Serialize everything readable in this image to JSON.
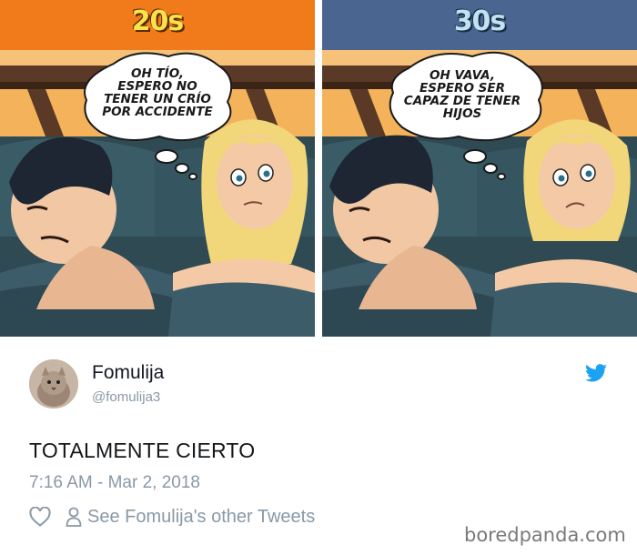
{
  "comic": {
    "panels": [
      {
        "title": "20s",
        "header_color": "#f17b1a",
        "bubble_text": "OH TÍO,\nESPERO NO\nTENER  UN CRÍO\nPOR ACCIDENTE"
      },
      {
        "title": "30s",
        "header_color": "#4a6690",
        "bubble_text": "OH VAVA,\nESPERO SER\nCAPAZ DE TENER\nHIJOS"
      }
    ]
  },
  "tweet": {
    "display_name": "Fomulija",
    "handle": "@fomulija3",
    "text": "TOTALMENTE CIERTO",
    "timestamp": "7:16 AM - Mar 2, 2018",
    "see_other_label": "See Fomulija's other Tweets",
    "icons": [
      "twitter-bird-icon",
      "heart-icon",
      "person-icon"
    ],
    "accent_color": "#1da1f2"
  },
  "watermark": "boredpanda.com"
}
